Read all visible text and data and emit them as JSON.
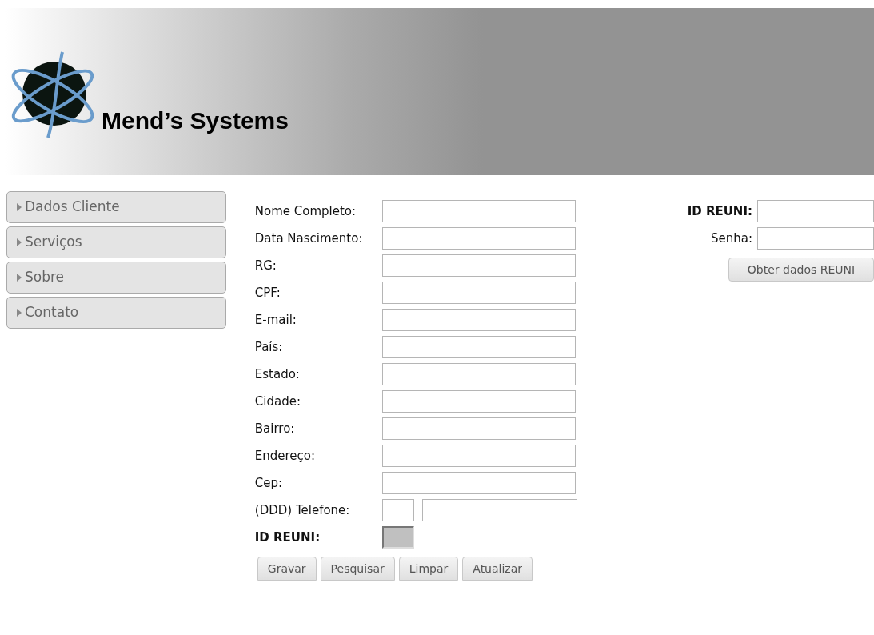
{
  "header": {
    "brand": "Mend’s Systems"
  },
  "sidebar": {
    "items": [
      {
        "label": "Dados Cliente"
      },
      {
        "label": "Serviços"
      },
      {
        "label": "Sobre"
      },
      {
        "label": "Contato"
      }
    ]
  },
  "form": {
    "fields": [
      {
        "label": "Nome Completo:",
        "kind": "text"
      },
      {
        "label": "Data Nascimento:",
        "kind": "text"
      },
      {
        "label": "RG:",
        "kind": "text"
      },
      {
        "label": "CPF:",
        "kind": "text"
      },
      {
        "label": "E-mail:",
        "kind": "text"
      },
      {
        "label": "País:",
        "kind": "text"
      },
      {
        "label": "Estado:",
        "kind": "text"
      },
      {
        "label": "Cidade:",
        "kind": "text"
      },
      {
        "label": "Bairro:",
        "kind": "text"
      },
      {
        "label": "Endereço:",
        "kind": "text"
      },
      {
        "label": "Cep:",
        "kind": "text"
      },
      {
        "label": "(DDD) Telefone:",
        "kind": "phone"
      },
      {
        "label": "ID REUNI:",
        "kind": "disabled"
      }
    ],
    "buttons": [
      "Gravar",
      "Pesquisar",
      "Limpar",
      "Atualizar"
    ]
  },
  "reuni": {
    "fields": [
      {
        "label": "ID REUNI:"
      },
      {
        "label": "Senha:"
      }
    ],
    "button": "Obter dados REUNI"
  }
}
